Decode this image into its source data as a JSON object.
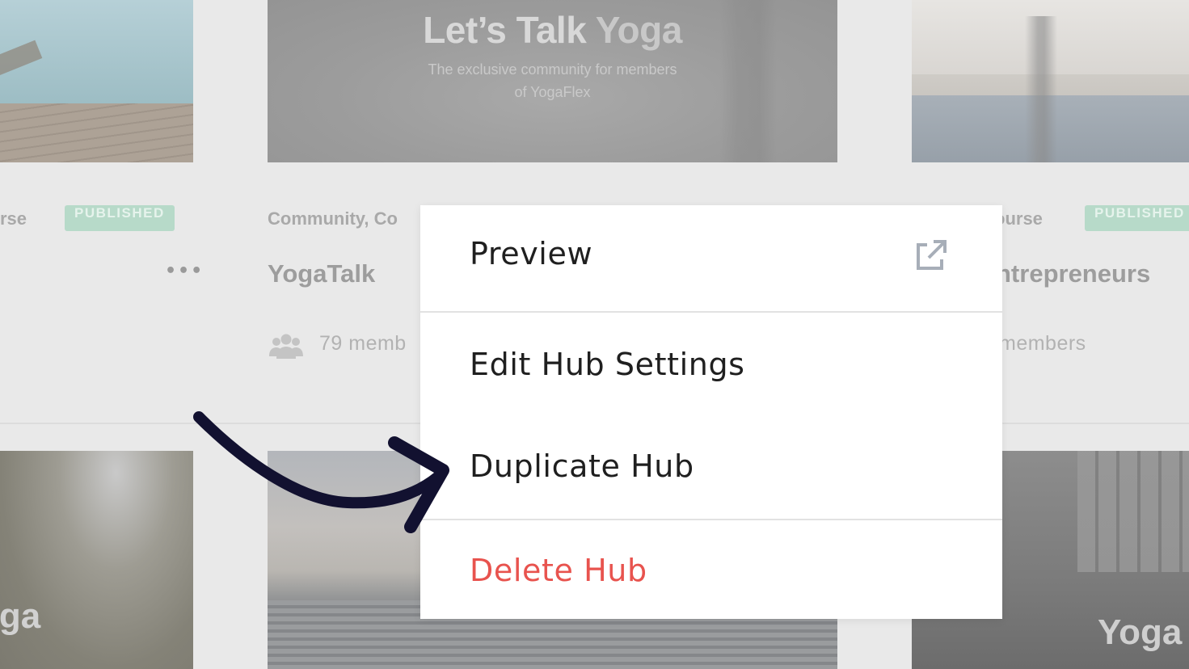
{
  "cards": {
    "yogatalk": {
      "banner_title_bold": "Let’s Talk",
      "banner_title_light": "Yoga",
      "banner_subtitle_line1": "The exclusive community for members",
      "banner_subtitle_line2": "of YogaFlex",
      "category": "Community, Co",
      "name": "YogaTalk",
      "members": "79 memb"
    },
    "left": {
      "category": "rse",
      "badge": "PUBLISHED",
      "more": "•••",
      "bottom_word": "oga"
    },
    "right": {
      "category": "ourse",
      "badge": "PUBLISHED",
      "name": "ntrepreneurs",
      "members": "members",
      "bottom_word": "Yoga"
    }
  },
  "menu": {
    "preview": "Preview",
    "preview_icon": "external-link-icon",
    "edit": "Edit Hub Settings",
    "duplicate": "Duplicate Hub",
    "delete": "Delete Hub"
  },
  "colors": {
    "delete_text": "#e8534e",
    "badge_bg": "#b7dac9",
    "arrow": "#121130"
  }
}
